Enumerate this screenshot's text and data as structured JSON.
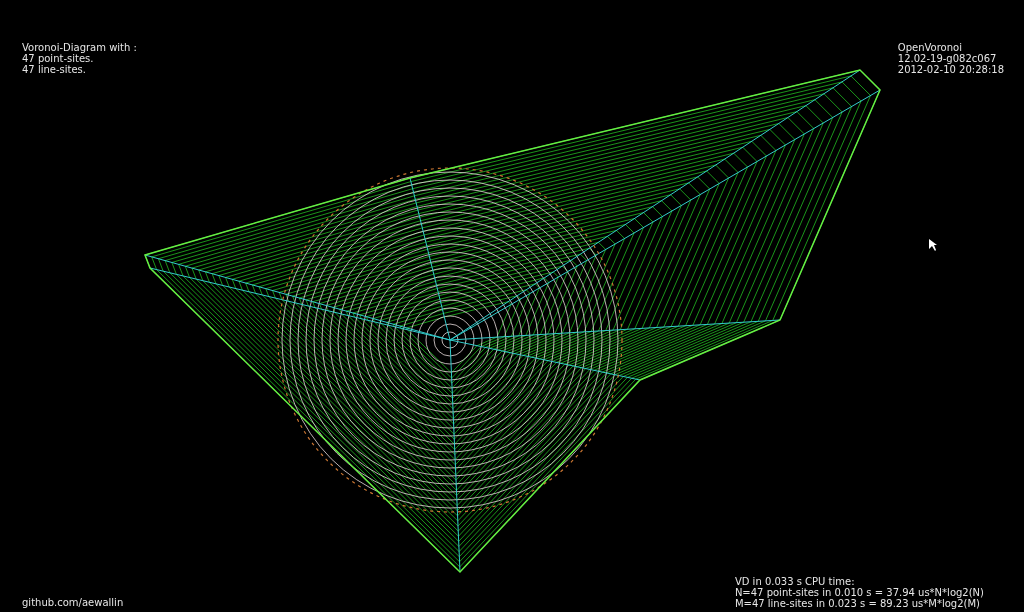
{
  "header_left": {
    "title": "Voronoi-Diagram with :",
    "lines": [
      "47 point-sites.",
      "47 line-sites."
    ]
  },
  "header_right": {
    "lines": [
      "OpenVoronoi",
      "12.02-19-g082c067",
      "2012-02-10 20:28:18"
    ]
  },
  "footer_left": {
    "link": "github.com/aewallin"
  },
  "footer_right": {
    "lines": [
      "VD in 0.033 s CPU time:",
      "N=47 point-sites in 0.010 s = 37.94 us*N*log2(N)",
      "M=47 line-sites in 0.023 s = 89.23 us*M*log2(M)"
    ]
  }
}
